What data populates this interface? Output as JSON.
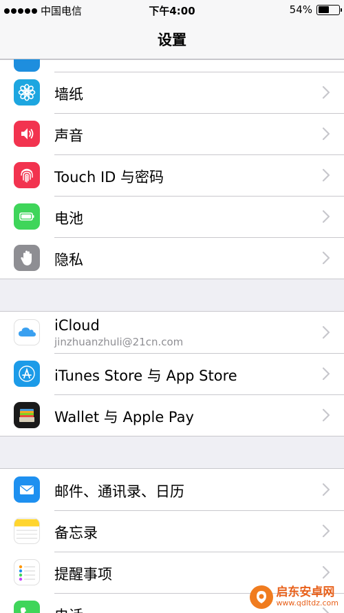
{
  "status_bar": {
    "carrier": "中国电信",
    "time": "下午4:00",
    "battery_text": "54%",
    "battery_level": 0.54
  },
  "nav": {
    "title": "设置"
  },
  "groups": [
    {
      "items": [
        {
          "label": "",
          "icon": "settings-icon",
          "color": "#1e8ede"
        },
        {
          "label": "墙纸",
          "icon": "wallpaper-flower-icon",
          "color": "#1da6e0"
        },
        {
          "label": "声音",
          "icon": "speaker-icon",
          "color": "#f2334f"
        },
        {
          "label": "Touch ID 与密码",
          "icon": "fingerprint-icon",
          "color": "#f2334f"
        },
        {
          "label": "电池",
          "icon": "battery-icon",
          "color": "#3fd55a"
        },
        {
          "label": "隐私",
          "icon": "hand-icon",
          "color": "#8e8e93"
        }
      ]
    },
    {
      "items": [
        {
          "label": "iCloud",
          "sublabel": "jinzhuanzhuli@21cn.com",
          "icon": "icloud-icon",
          "color": "#ffffff"
        },
        {
          "label": "iTunes Store 与 App Store",
          "icon": "app-store-icon",
          "color": "#1c9be8"
        },
        {
          "label": "Wallet 与 Apple Pay",
          "icon": "wallet-icon",
          "color": "#1a1a1a"
        }
      ]
    },
    {
      "items": [
        {
          "label": "邮件、通讯录、日历",
          "icon": "mail-icon",
          "color": "#1e90f0"
        },
        {
          "label": "备忘录",
          "icon": "notes-icon",
          "color": "#ffd52e"
        },
        {
          "label": "提醒事项",
          "icon": "reminders-icon",
          "color": "#ffffff"
        },
        {
          "label": "电话",
          "icon": "phone-icon",
          "color": "#3fd55a"
        }
      ]
    }
  ],
  "watermark": {
    "main": "启东安卓网",
    "sub": "www.qdltdz.com"
  }
}
